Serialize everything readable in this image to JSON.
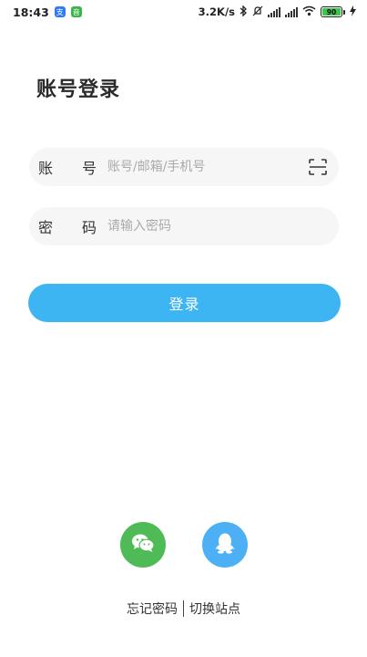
{
  "status_bar": {
    "time": "18:43",
    "app_badge_1": "支",
    "app_badge_2": "音",
    "network_speed": "3.2K/s",
    "battery_level": "90"
  },
  "page": {
    "title": "账号登录"
  },
  "form": {
    "account": {
      "label_char_1": "账",
      "label_char_2": "号",
      "placeholder": "账号/邮箱/手机号",
      "value": ""
    },
    "password": {
      "label_char_1": "密",
      "label_char_2": "码",
      "placeholder": "请输入密码",
      "value": ""
    },
    "login_button_label": "登录"
  },
  "social": {
    "wechat_icon": "wechat-icon",
    "qq_icon": "qq-icon"
  },
  "footer": {
    "forgot_password": "忘记密码",
    "switch_site": "切换站点"
  },
  "colors": {
    "primary": "#3db5f3",
    "wechat": "#4fbb57",
    "qq": "#4db0f5",
    "field_bg": "#f6f6f7"
  }
}
